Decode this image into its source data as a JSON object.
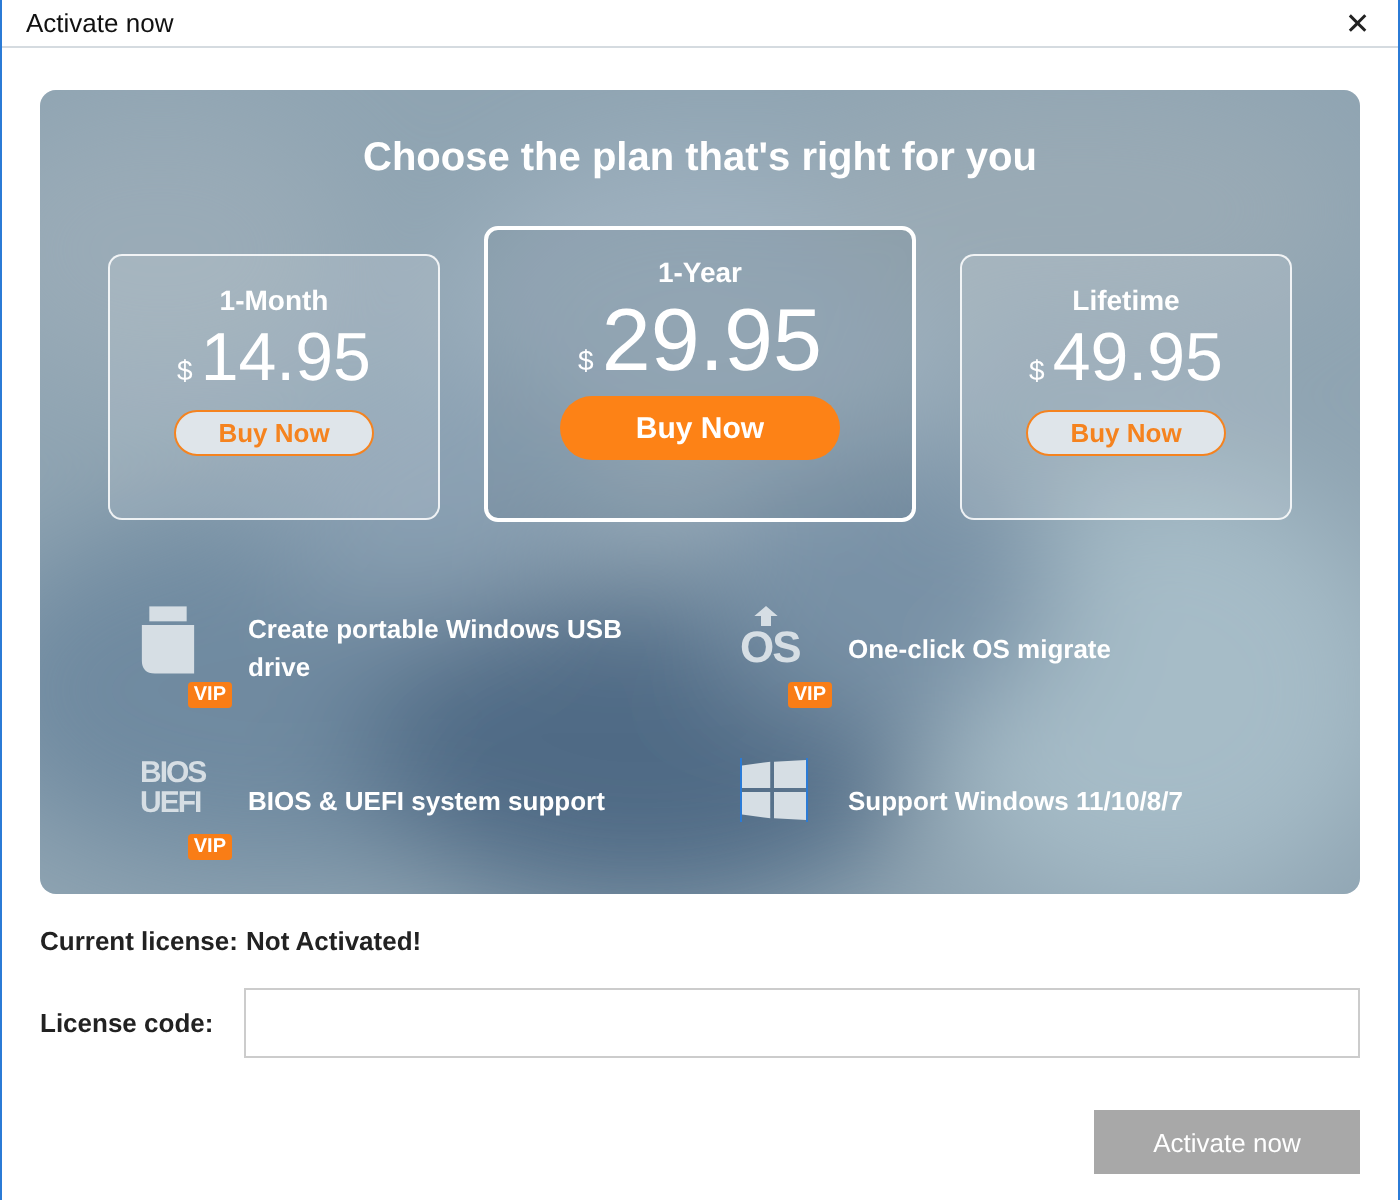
{
  "window": {
    "title": "Activate now",
    "close": "✕"
  },
  "heading": "Choose the plan that's right for you",
  "plans": [
    {
      "name": "1-Month",
      "currency": "$",
      "price": "14.95",
      "button": "Buy Now",
      "selected": false
    },
    {
      "name": "1-Year",
      "currency": "$",
      "price": "29.95",
      "button": "Buy Now",
      "selected": true
    },
    {
      "name": "Lifetime",
      "currency": "$",
      "price": "49.95",
      "button": "Buy Now",
      "selected": false
    }
  ],
  "features": [
    {
      "kind": "usb",
      "text": "Create portable Windows USB drive",
      "badge": "VIP"
    },
    {
      "kind": "os",
      "icon_text": [
        "OS"
      ],
      "text": "One-click OS migrate",
      "badge": "VIP"
    },
    {
      "kind": "bios",
      "icon_text": [
        "BIOS",
        "UEFI"
      ],
      "text": "BIOS & UEFI system support",
      "badge": "VIP"
    },
    {
      "kind": "windows",
      "text": "Support Windows 11/10/8/7"
    }
  ],
  "license": {
    "label": "Current license:",
    "value": "Not Activated!"
  },
  "code": {
    "label": "License code:"
  },
  "activate": {
    "label": "Activate now",
    "disabled": true
  }
}
